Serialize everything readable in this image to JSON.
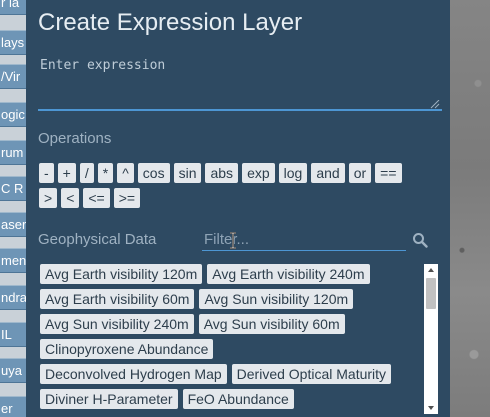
{
  "background_sidebar": {
    "items": [
      "r la",
      "lays",
      "/Vir",
      "ogic",
      "rum",
      "C R",
      "aser",
      "ment",
      "ndra",
      "IL",
      "uya",
      "er"
    ]
  },
  "modal": {
    "title": "Create Expression Layer",
    "expression_placeholder": "Enter expression",
    "operations_label": "Operations",
    "operations_row1": [
      "-",
      "+",
      "/",
      "*",
      "^",
      "cos",
      "sin",
      "abs",
      "exp",
      "log",
      "and",
      "or",
      "=="
    ],
    "operations_row2": [
      ">",
      "<",
      "<=",
      ">="
    ],
    "geophysical_label": "Geophysical Data",
    "filter_placeholder": "Filter...",
    "data_rows": [
      [
        "Avg Earth visibility 120m",
        "Avg Earth visibility 240m"
      ],
      [
        "Avg Earth visibility 60m",
        "Avg Sun visibility 120m"
      ],
      [
        "Avg Sun visibility 240m",
        "Avg Sun visibility 60m"
      ],
      [
        "Clinopyroxene Abundance"
      ],
      [
        "Deconvolved Hydrogen Map",
        "Derived Optical Maturity"
      ],
      [
        "Diviner H-Parameter",
        "FeO Abundance"
      ]
    ]
  },
  "icons": {
    "search": "search-icon",
    "cursor": "text-cursor-icon",
    "scroll_up": "chevron-up-icon",
    "scroll_down": "chevron-down-icon"
  },
  "colors": {
    "modal_bg": "#2e4a62",
    "accent": "#4d96d3",
    "chip_bg": "#e4e8ec",
    "chip_text": "#2d3e4c",
    "sidebar_item": "#6e95b6"
  }
}
